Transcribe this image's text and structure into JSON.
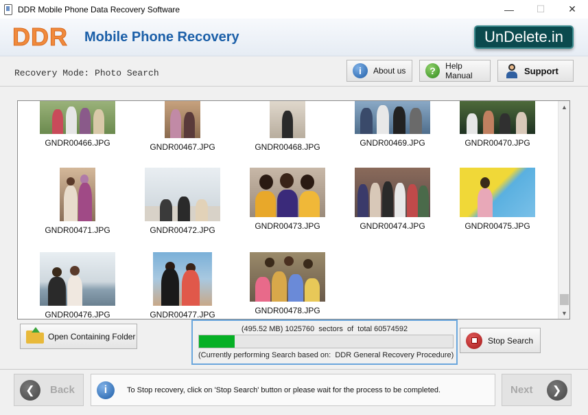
{
  "window": {
    "title": "DDR Mobile Phone Data Recovery Software",
    "minimize": "—",
    "maximize": "☐",
    "close": "✕"
  },
  "header": {
    "logo": "DDR",
    "product_name": "Mobile Phone Recovery",
    "site_badge": "UnDelete.in"
  },
  "mode": {
    "label": "Recovery Mode: Photo Search"
  },
  "toolbar": {
    "about": "About us",
    "help": "Help Manual",
    "support": "Support"
  },
  "gallery": {
    "files": [
      "GNDR00466.JPG",
      "GNDR00467.JPG",
      "GNDR00468.JPG",
      "GNDR00469.JPG",
      "GNDR00470.JPG",
      "GNDR00471.JPG",
      "GNDR00472.JPG",
      "GNDR00473.JPG",
      "GNDR00474.JPG",
      "GNDR00475.JPG",
      "GNDR00476.JPG",
      "GNDR00477.JPG",
      "GNDR00478.JPG"
    ]
  },
  "actions": {
    "open_folder": "Open Containing Folder",
    "stop_search": "Stop Search"
  },
  "progress": {
    "size": "(495.52 MB)",
    "sectors_done": "1025760",
    "sectors_word": "sectors",
    "of_total_word": "of  total",
    "total_sectors": "60574592",
    "status": "(Currently performing Search based on:  DDR General Recovery Procedure)",
    "fraction": 0.14,
    "fill_color": "#06b025"
  },
  "footer": {
    "back": "Back",
    "next": "Next",
    "info": "To Stop recovery, click on 'Stop Search' button or please wait for the process to be completed."
  },
  "icons": {
    "info": "info-icon",
    "help": "question-icon",
    "support": "support-person-icon",
    "folder": "folder-icon",
    "stop": "stop-icon"
  }
}
